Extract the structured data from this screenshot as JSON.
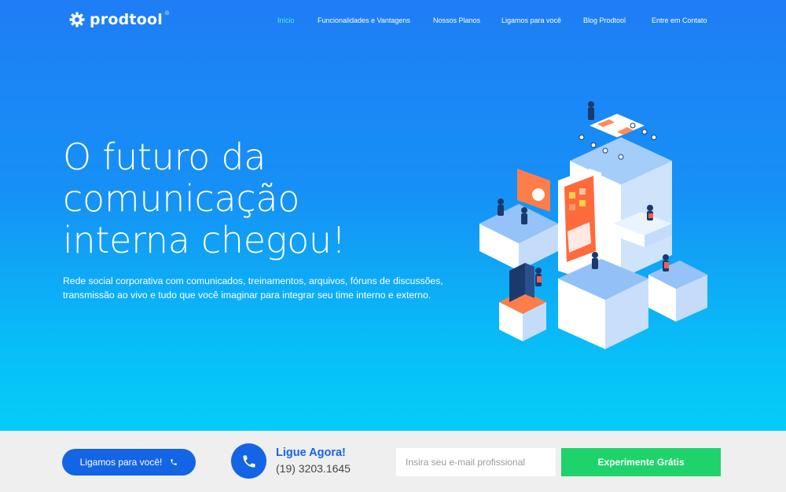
{
  "brand": {
    "name": "prodtool",
    "registered_mark": "®"
  },
  "nav": {
    "items": [
      {
        "label": "Início",
        "active": true
      },
      {
        "label": "Funcionalidades e Vantagens"
      },
      {
        "label": "Nossos Planos"
      },
      {
        "label": "Ligamos para você"
      },
      {
        "label": "Blog Prodtool"
      },
      {
        "label": "Entre em Contato"
      }
    ]
  },
  "hero": {
    "headline_lines": [
      "O futuro da",
      "comunicação",
      "interna chegou!"
    ],
    "subtitle_lines": [
      "Rede social corporativa com comunicados, treinamentos, arquivos, fóruns de discussões,",
      "transmissão ao vivo e tudo que você imaginar para integrar seu time interno e externo."
    ],
    "illustration_icon": "isometric-office-illustration"
  },
  "footer_bar": {
    "call_button_label": "Ligamos para você!",
    "call_title": "Ligue Agora!",
    "call_phone": "(19) 3203.1645",
    "email_placeholder": "Insira seu e-mail profissional",
    "email_value": "",
    "cta_label": "Experimente Grátis"
  },
  "colors": {
    "hero_top": "#1f7df5",
    "hero_bottom": "#04cef8",
    "accent_blue": "#1464e6",
    "cta_green": "#1fd36b",
    "nav_active": "#52f0e8"
  }
}
